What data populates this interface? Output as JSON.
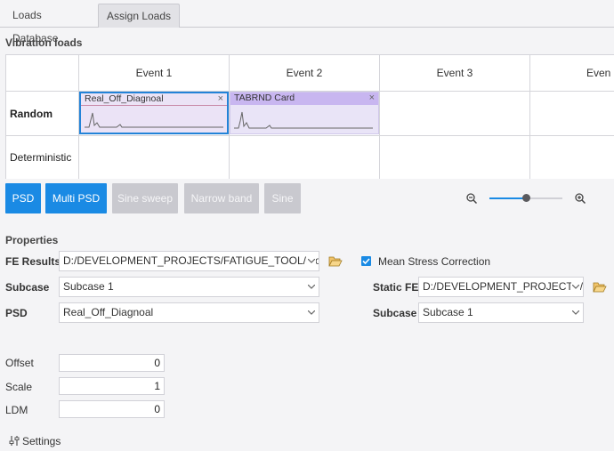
{
  "tabs": [
    {
      "label": "Loads Database"
    },
    {
      "label": "Assign Loads"
    }
  ],
  "vibration": {
    "title": "Vibration loads",
    "events": [
      "Event 1",
      "Event 2",
      "Event 3",
      "Even"
    ],
    "rows": [
      "Random",
      "Deterministic"
    ],
    "loads": [
      {
        "name": "Real_Off_Diagnoal",
        "close": "×"
      },
      {
        "name": "TABRND  Card",
        "close": "×"
      }
    ]
  },
  "toolbar": {
    "buttons": [
      "PSD",
      "Multi PSD",
      "Sine sweep",
      "Narrow band",
      "Sine"
    ],
    "zoom_level": 0.5
  },
  "properties": {
    "title": "Properties",
    "fe_results_label": "FE Results",
    "fe_results_value": "D:/DEVELOPMENT_PROJECTS/FATIGUE_TOOL/Mode",
    "mean_stress_label": "Mean Stress Correction",
    "mean_stress_checked": true,
    "subcase_label": "Subcase",
    "subcase_value": "Subcase 1",
    "static_fe_label": "Static FE",
    "static_fe_value": "D:/DEVELOPMENT_PROJECTS/",
    "psd_label": "PSD",
    "psd_value": "Real_Off_Diagnoal",
    "static_subcase_label": "Subcase",
    "static_subcase_value": "Subcase 1"
  },
  "params": [
    {
      "label": "Offset",
      "value": "0"
    },
    {
      "label": "Scale",
      "value": "1"
    },
    {
      "label": "LDM",
      "value": "0"
    }
  ],
  "settings": {
    "label": "Settings"
  }
}
